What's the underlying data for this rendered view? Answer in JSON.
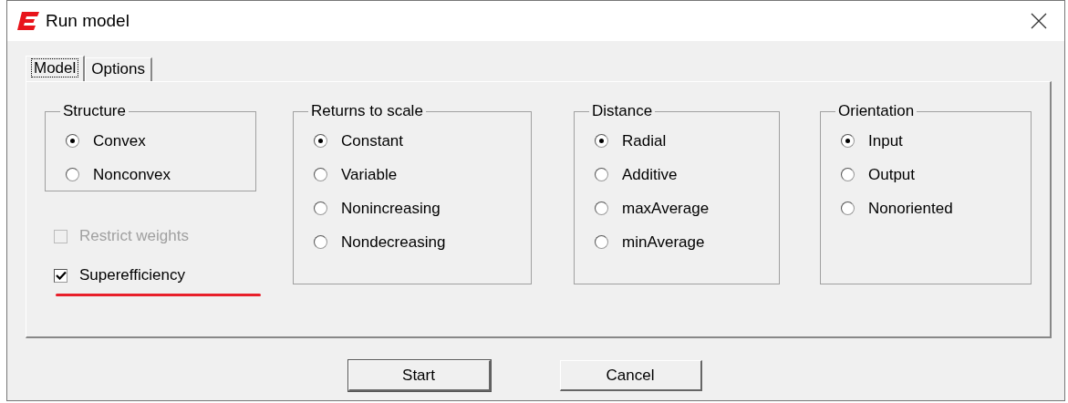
{
  "window": {
    "title": "Run model"
  },
  "tabs": [
    {
      "label": "Model",
      "selected": true
    },
    {
      "label": "Options",
      "selected": false
    }
  ],
  "groups": [
    {
      "title": "Structure",
      "options": [
        {
          "label": "Convex",
          "selected": true
        },
        {
          "label": "Nonconvex",
          "selected": false
        }
      ]
    },
    {
      "title": "Returns to scale",
      "options": [
        {
          "label": "Constant",
          "selected": true
        },
        {
          "label": "Variable",
          "selected": false
        },
        {
          "label": "Nonincreasing",
          "selected": false
        },
        {
          "label": "Nondecreasing",
          "selected": false
        }
      ]
    },
    {
      "title": "Distance",
      "options": [
        {
          "label": "Radial",
          "selected": true
        },
        {
          "label": "Additive",
          "selected": false
        },
        {
          "label": "maxAverage",
          "selected": false
        },
        {
          "label": "minAverage",
          "selected": false
        }
      ]
    },
    {
      "title": "Orientation",
      "options": [
        {
          "label": "Input",
          "selected": true
        },
        {
          "label": "Output",
          "selected": false
        },
        {
          "label": "Nonoriented",
          "selected": false
        }
      ]
    }
  ],
  "checkboxes": [
    {
      "label": "Restrict weights",
      "checked": false,
      "disabled": true,
      "highlighted": false
    },
    {
      "label": "Superefficiency",
      "checked": true,
      "disabled": false,
      "highlighted": true
    }
  ],
  "buttons": [
    {
      "label": "Start",
      "default": true
    },
    {
      "label": "Cancel",
      "default": false
    }
  ]
}
